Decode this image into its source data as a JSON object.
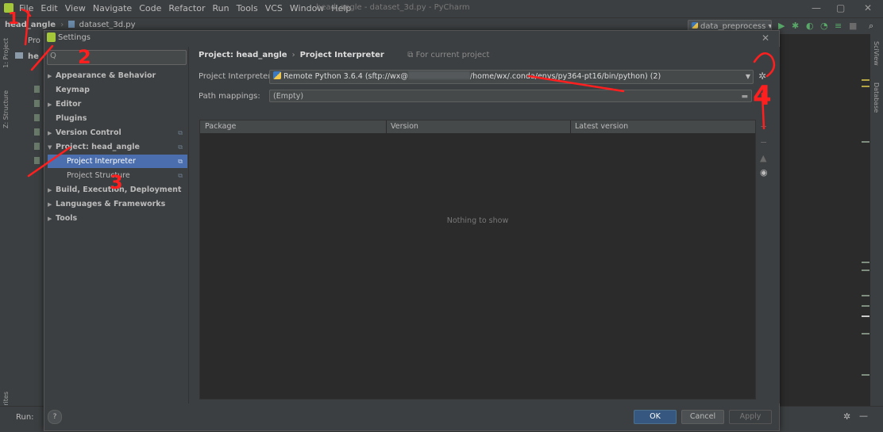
{
  "menubar": {
    "items": [
      "File",
      "Edit",
      "View",
      "Navigate",
      "Code",
      "Refactor",
      "Run",
      "Tools",
      "VCS",
      "Window",
      "Help"
    ],
    "window_title": "head_angle - dataset_3d.py - PyCharm"
  },
  "navbar": {
    "project": "head_angle",
    "file": "dataset_3d.py",
    "run_config": "data_preprocess"
  },
  "left_stripe": {
    "project_tab": "1: Project",
    "structure_tab": "Z: Structure",
    "favorites_tab": "2: Favorites"
  },
  "right_stripe": {
    "sciview_tab": "SciView",
    "database_tab": "Database"
  },
  "project_panel": {
    "label": "Pro",
    "root": "he"
  },
  "runbar": {
    "label": "Run:"
  },
  "dialog": {
    "title": "Settings",
    "search_placeholder": "Q",
    "tree": [
      {
        "label": "Appearance & Behavior",
        "expand": "▶"
      },
      {
        "label": "Keymap",
        "expand": ""
      },
      {
        "label": "Editor",
        "expand": "▶"
      },
      {
        "label": "Plugins",
        "expand": ""
      },
      {
        "label": "Version Control",
        "expand": "▶"
      },
      {
        "label": "Project: head_angle",
        "expand": "▼"
      },
      {
        "label": "Project Interpreter",
        "expand": ""
      },
      {
        "label": "Project Structure",
        "expand": ""
      },
      {
        "label": "Build, Execution, Deployment",
        "expand": "▶"
      },
      {
        "label": "Languages & Frameworks",
        "expand": "▶"
      },
      {
        "label": "Tools",
        "expand": "▶"
      }
    ],
    "breadcrumb": {
      "project": "Project: head_angle",
      "page": "Project Interpreter",
      "scope": "For current project"
    },
    "interpreter_label": "Project Interpreter:",
    "interpreter_prefix": "Remote Python 3.6.4 (sftp://wx@",
    "interpreter_suffix": "/home/wx/.conda/envs/py364-pt16/bin/python) (2)",
    "path_label": "Path mappings:",
    "path_value": "(Empty)",
    "table_headers": [
      "Package",
      "Version",
      "Latest version"
    ],
    "empty_text": "Nothing to show",
    "help": "?",
    "ok": "OK",
    "cancel": "Cancel",
    "apply": "Apply"
  },
  "annotations": [
    "1",
    "2",
    "3",
    "4"
  ],
  "colors": {
    "selection": "#4b6eaf",
    "annotation": "#ff1f1f",
    "ok_button": "#365880"
  }
}
